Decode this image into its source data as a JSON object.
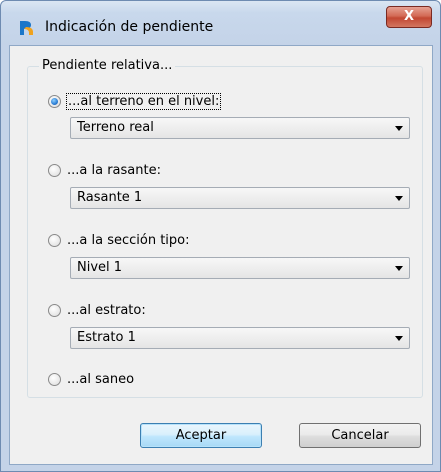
{
  "window": {
    "title": "Indicación de pendiente",
    "close_label": "X"
  },
  "group": {
    "legend": "Pendiente relativa..."
  },
  "options": [
    {
      "label": "...al terreno en el nivel:",
      "selected": true,
      "combo_value": "Terreno real"
    },
    {
      "label": "...a la rasante:",
      "selected": false,
      "combo_value": "Rasante 1"
    },
    {
      "label": "...a la sección tipo:",
      "selected": false,
      "combo_value": "Nivel 1"
    },
    {
      "label": "...al estrato:",
      "selected": false,
      "combo_value": "Estrato 1"
    },
    {
      "label": "...al saneo",
      "selected": false
    }
  ],
  "buttons": {
    "accept": "Aceptar",
    "cancel": "Cancelar"
  },
  "icons": {
    "app": "app-logo-icon",
    "close": "close-icon"
  }
}
